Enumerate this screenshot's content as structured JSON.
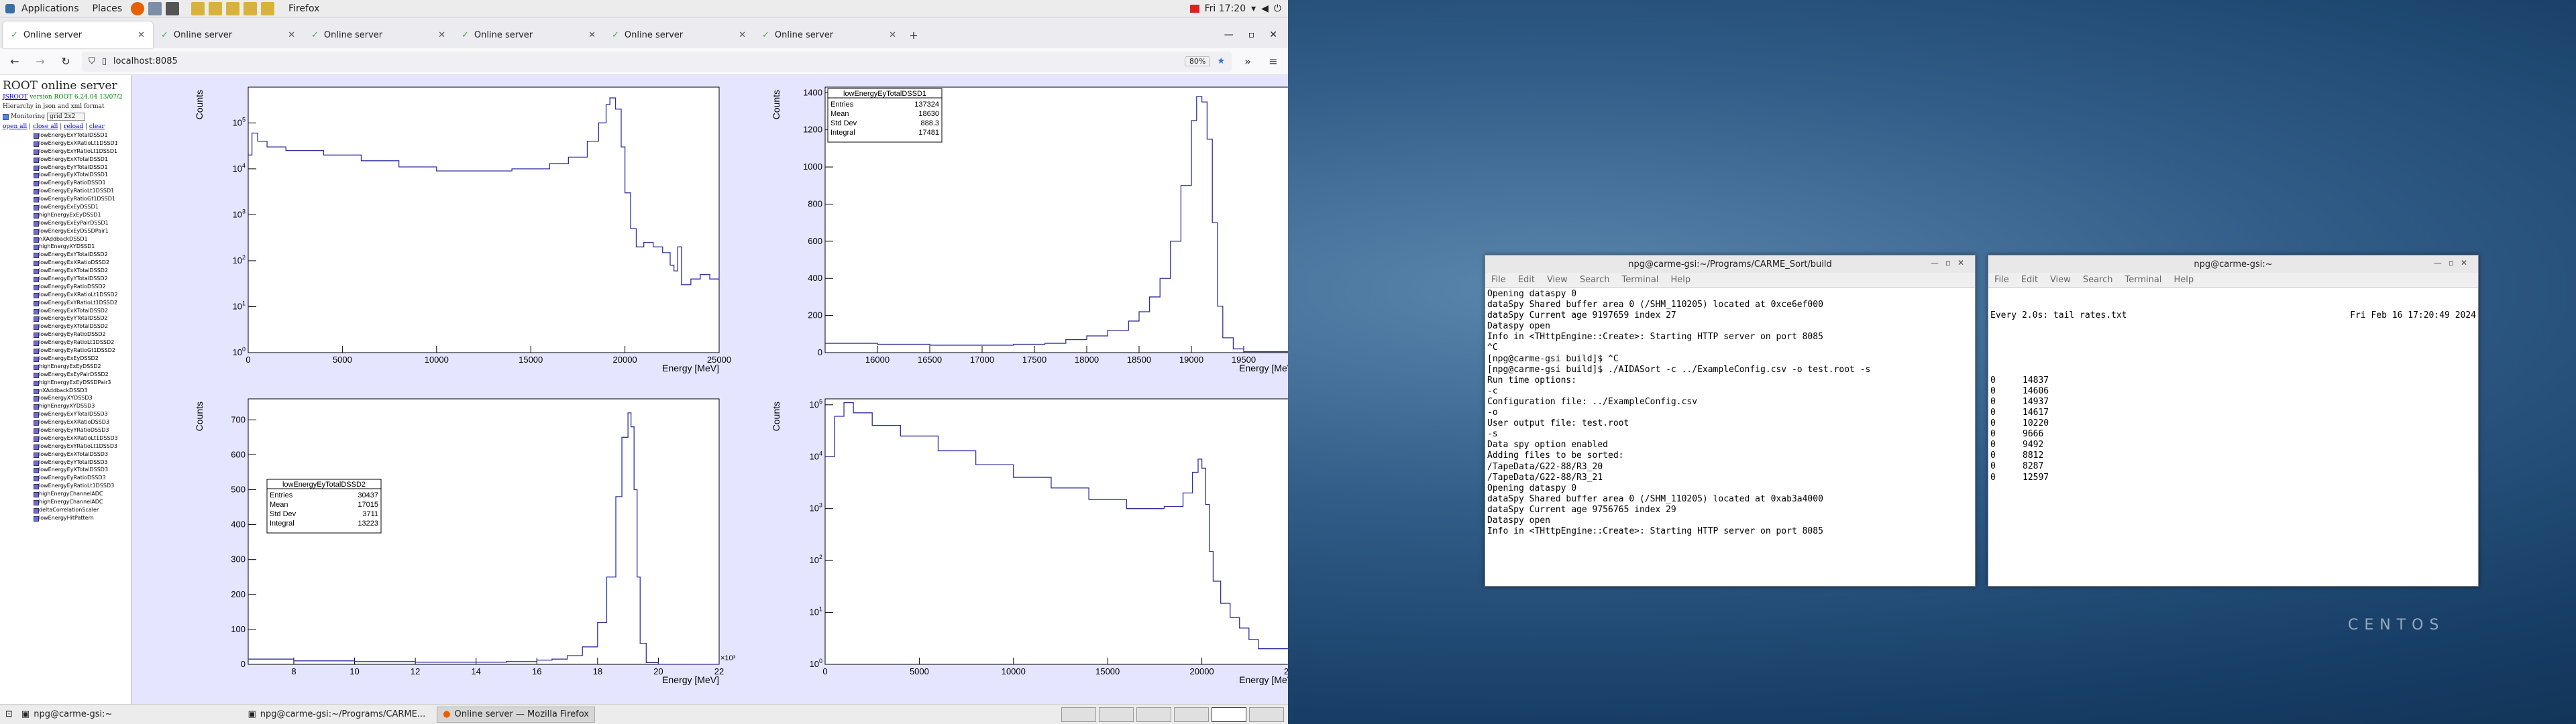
{
  "panel": {
    "applications": "Applications",
    "places": "Places",
    "firefox": "Firefox",
    "clock": "Fri 17:20"
  },
  "browser": {
    "tabs": [
      "Online server",
      "Online server",
      "Online server",
      "Online server",
      "Online server",
      "Online server"
    ],
    "url": "localhost:8085",
    "zoom": "80%"
  },
  "root": {
    "title": "ROOT online server",
    "version_text": "version ROOT 6.24.04 13/07/2",
    "root_link": "JSROOT",
    "hierarchy_text": "Hierarchy in json and xml format",
    "monitoring_label": "Monitoring",
    "layout_value": "grid 2x2",
    "links": [
      "open all",
      "close all",
      "reload",
      "clear"
    ],
    "items": [
      "lowEnergyExYTotalDSSD1",
      "lowEnergyExXRatioLt1DSSD1",
      "lowEnergyExYRatioLt1DSSD1",
      "lowEnergyExXTotalDSSD1",
      "lowEnergyEyYTotalDSSD1",
      "lowEnergyEyXTotalDSSD1",
      "lowEnergyEyRatioDSSD1",
      "lowEnergyEyRatioLt1DSSD1",
      "lowEnergyEyRatioGt1DSSD1",
      "lowEnergyExEyDSSD1",
      "highEnergyExEyDSSD1",
      "lowEnergyExEyPairDSSD1",
      "lowEnergyExEyDSSDPair1",
      "nXAddbackDSSD1",
      "highEnergyXYDSSD1",
      "lowEnergyExYTotalDSSD2",
      "lowEnergyExXRatioDSSD2",
      "lowEnergyExXTotalDSSD2",
      "lowEnergyEyYTotalDSSD2",
      "lowEnergyEyRatioDSSD2",
      "lowEnergyExXRatioLt1DSSD2",
      "lowEnergyExYRatioLt1DSSD2",
      "lowEnergyExXTotalDSSD2",
      "lowEnergyEyYTotalDSSD2",
      "lowEnergyEyXTotalDSSD2",
      "lowEnergyEyRatioDSSD2",
      "lowEnergyEyRatioLt1DSSD2",
      "lowEnergyEyRatioGt1DSSD2",
      "lowEnergyExEyDSSD2",
      "highEnergyExEyDSSD2",
      "lowEnergyExEyPairDSSD2",
      "highEnergyExEyDSSDPair3",
      "nXAddbackDSSD3",
      "lowEnergyXYDSSD3",
      "highEnergyXYDSSD3",
      "lowEnergyExYTotalDSSD3",
      "lowEnergyExXRatioDSSD3",
      "lowEnergyEyYRatioDSSD3",
      "lowEnergyExXRatioLt1DSSD3",
      "lowEnergyExYRatioLt1DSSD3",
      "lowEnergyExXTotalDSSD3",
      "lowEnergyEyYTotalDSSD3",
      "lowEnergyEyXTotalDSSD3",
      "lowEnergyEyRatioDSSD3",
      "lowEnergyEyRatioLt1DSSD3",
      "highEnergyChannelADC",
      "highEnergyChannelADC",
      "deltaCorrelationScaler",
      "lowEnergyHitPattern"
    ]
  },
  "chart_data": [
    {
      "type": "line",
      "name": "pad1",
      "log_y": true,
      "xlabel": "Energy [MeV]",
      "ylabel": "Counts",
      "xlim": [
        0,
        25000
      ],
      "ylim": [
        1,
        600000
      ],
      "xticks": [
        "0",
        "5000",
        "10000",
        "15000",
        "20000",
        "25000"
      ],
      "yticks": [
        1,
        10,
        100,
        1000,
        10000,
        100000
      ],
      "x": [
        0,
        200,
        500,
        1000,
        2000,
        4000,
        6000,
        8000,
        10000,
        12000,
        14000,
        16000,
        17000,
        18000,
        18600,
        19000,
        19200,
        19500,
        19800,
        20000,
        20300,
        20600,
        21000,
        21500,
        22000,
        22400,
        22600,
        22800,
        23000,
        23500,
        24000,
        24500,
        25000
      ],
      "y": [
        20000,
        60000,
        40000,
        30000,
        25000,
        20000,
        15000,
        11000,
        9000,
        9000,
        10000,
        13000,
        18000,
        40000,
        100000,
        250000,
        350000,
        200000,
        30000,
        3000,
        500,
        200,
        250,
        200,
        150,
        80,
        60,
        200,
        30,
        40,
        50,
        40,
        60
      ]
    },
    {
      "type": "line",
      "name": "pad2",
      "log_y": false,
      "xlabel": "Energy [MeV]",
      "ylabel": "Counts",
      "xlim": [
        15500,
        20000
      ],
      "ylim": [
        0,
        1430
      ],
      "xticks": [
        "16000",
        "16500",
        "17000",
        "17500",
        "18000",
        "18500",
        "19000",
        "19500"
      ],
      "yticks": [
        0,
        200,
        400,
        600,
        800,
        1000,
        1200,
        1400
      ],
      "x": [
        15500,
        16000,
        16500,
        17000,
        17300,
        17600,
        17800,
        18000,
        18200,
        18400,
        18500,
        18600,
        18700,
        18800,
        18900,
        19000,
        19050,
        19100,
        19150,
        19200,
        19250,
        19300,
        19400,
        19500,
        20000
      ],
      "y": [
        50,
        45,
        40,
        40,
        45,
        50,
        70,
        90,
        120,
        170,
        220,
        300,
        400,
        600,
        900,
        1250,
        1380,
        1350,
        1150,
        700,
        250,
        80,
        20,
        5,
        0
      ],
      "stats": {
        "name": "lowEnergyEyTotalDSSD1",
        "entries": "137324",
        "mean": "18630",
        "stddev": "888.3",
        "integral": "17481"
      }
    },
    {
      "type": "line",
      "name": "pad3",
      "log_y": false,
      "xlabel": "Energy [MeV]",
      "ylabel": "Counts",
      "xlim": [
        6500,
        22000
      ],
      "ylim": [
        0,
        760
      ],
      "x_multiplier": "×10³",
      "xticks": [
        "8",
        "10",
        "12",
        "14",
        "16",
        "18",
        "20",
        "22"
      ],
      "yticks": [
        0,
        100,
        200,
        300,
        400,
        500,
        600,
        700
      ],
      "x": [
        6500,
        8000,
        10000,
        12000,
        14000,
        15000,
        16000,
        16500,
        17000,
        17500,
        18000,
        18300,
        18600,
        18800,
        19000,
        19100,
        19200,
        19300,
        19400,
        19600,
        20000,
        22000
      ],
      "y": [
        15,
        10,
        8,
        6,
        6,
        8,
        12,
        15,
        25,
        50,
        120,
        250,
        480,
        650,
        720,
        680,
        500,
        250,
        60,
        5,
        0,
        0
      ],
      "stats": {
        "name": "lowEnergyEyTotalDSSD2",
        "entries": "30437",
        "mean": "17015",
        "stddev": "3711",
        "integral": "13223"
      }
    },
    {
      "type": "line",
      "name": "pad4",
      "log_y": true,
      "xlabel": "Energy [MeV]",
      "ylabel": "Counts",
      "xlim": [
        0,
        25000
      ],
      "ylim": [
        1,
        130000
      ],
      "xticks": [
        "0",
        "5000",
        "10000",
        "15000",
        "20000",
        "25000"
      ],
      "yticks": [
        1,
        10,
        100,
        1000,
        10000,
        100000
      ],
      "x": [
        0,
        500,
        1000,
        1500,
        2500,
        4000,
        6000,
        8000,
        10000,
        12000,
        14000,
        16000,
        18000,
        19000,
        19500,
        19800,
        20000,
        20200,
        20400,
        20600,
        21000,
        21500,
        22000,
        22500,
        23000,
        24000,
        25000
      ],
      "y": [
        10000,
        60000,
        110000,
        70000,
        40000,
        25000,
        13000,
        7000,
        4000,
        2500,
        1500,
        1000,
        1100,
        2000,
        5000,
        9000,
        6000,
        1200,
        150,
        40,
        15,
        8,
        5,
        3,
        2,
        2,
        1
      ]
    }
  ],
  "terminal1": {
    "title": "npg@carme-gsi:~/Programs/CARME_Sort/build",
    "menu": [
      "File",
      "Edit",
      "View",
      "Search",
      "Terminal",
      "Help"
    ],
    "lines": [
      "Opening dataspy 0",
      "dataSpy Shared buffer area 0 (/SHM_110205) located at 0xce6ef000",
      "dataSpy Current age 9197659 index 27",
      "Dataspy open",
      "Info in <THttpEngine::Create>: Starting HTTP server on port 8085",
      "^C",
      "[npg@carme-gsi build]$ ^C",
      "[npg@carme-gsi build]$ ./AIDASort -c ../ExampleConfig.csv -o test.root -s",
      "Run time options:",
      "-c",
      "Configuration file: ../ExampleConfig.csv",
      "-o",
      "User output file: test.root",
      "-s",
      "Data spy option enabled",
      "Adding files to be sorted:",
      "/TapeData/G22-88/R3_20",
      "/TapeData/G22-88/R3_21",
      "Opening dataspy 0",
      "dataSpy Shared buffer area 0 (/SHM_110205) located at 0xab3a4000",
      "dataSpy Current age 9756765 index 29",
      "Dataspy open",
      "Info in <THttpEngine::Create>: Starting HTTP server on port 8085"
    ]
  },
  "terminal2": {
    "title": "npg@carme-gsi:~",
    "menu": [
      "File",
      "Edit",
      "View",
      "Search",
      "Terminal",
      "Help"
    ],
    "header_left": "Every 2.0s: tail rates.txt",
    "header_right": "Fri Feb 16 17:20:49 2024",
    "rows": [
      [
        "0",
        "14837"
      ],
      [
        "0",
        "14606"
      ],
      [
        "0",
        "14937"
      ],
      [
        "0",
        "14617"
      ],
      [
        "0",
        "10220"
      ],
      [
        "0",
        "9666"
      ],
      [
        "0",
        "9492"
      ],
      [
        "0",
        "8812"
      ],
      [
        "0",
        "8287"
      ],
      [
        "0",
        "12597"
      ]
    ]
  },
  "taskbar": [
    "npg@carme-gsi:~",
    "npg@carme-gsi:~/Programs/CARME...",
    "Online server — Mozilla Firefox"
  ],
  "desktop": {
    "brand": "CENTOS"
  },
  "colors": {
    "histogram": "#3030a0",
    "sidebar_bg": "#e5e5ff"
  }
}
